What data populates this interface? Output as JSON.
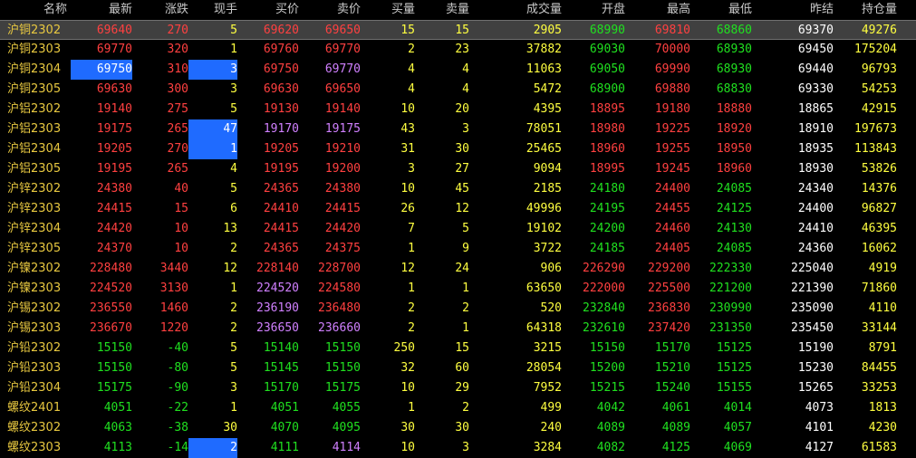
{
  "columns": [
    "名称",
    "最新",
    "涨跌",
    "现手",
    "买价",
    "卖价",
    "买量",
    "卖量",
    "成交量",
    "开盘",
    "最高",
    "最低",
    "昨结",
    "持仓量"
  ],
  "colors": {
    "up": "#ff4040",
    "down": "#20e020",
    "neutral": "#ffffff",
    "yellow": "#ffff40",
    "name": "#e8c840",
    "violet": "#d080ff",
    "highlight": "#1f6bff"
  },
  "rows": [
    {
      "name": "沪铜2302",
      "last": "69640",
      "chg": "270",
      "vol": "5",
      "bid": "69620",
      "ask": "69650",
      "bidq": "15",
      "askq": "15",
      "tvol": "2905",
      "open": "68990",
      "high": "69810",
      "low": "68860",
      "pre": "69370",
      "oi": "49276"
    },
    {
      "name": "沪铜2303",
      "last": "69770",
      "chg": "320",
      "vol": "1",
      "bid": "69760",
      "ask": "69770",
      "bidq": "2",
      "askq": "23",
      "tvol": "37882",
      "open": "69030",
      "high": "70000",
      "low": "68930",
      "pre": "69450",
      "oi": "175204"
    },
    {
      "name": "沪铜2304",
      "last": "69750",
      "chg": "310",
      "vol": "3",
      "bid": "69750",
      "ask": "69770",
      "bidq": "4",
      "askq": "4",
      "tvol": "11063",
      "open": "69050",
      "high": "69990",
      "low": "68930",
      "pre": "69440",
      "oi": "96793"
    },
    {
      "name": "沪铜2305",
      "last": "69630",
      "chg": "300",
      "vol": "3",
      "bid": "69630",
      "ask": "69650",
      "bidq": "4",
      "askq": "4",
      "tvol": "5472",
      "open": "68900",
      "high": "69880",
      "low": "68830",
      "pre": "69330",
      "oi": "54253"
    },
    {
      "name": "沪铝2302",
      "last": "19140",
      "chg": "275",
      "vol": "5",
      "bid": "19130",
      "ask": "19140",
      "bidq": "10",
      "askq": "20",
      "tvol": "4395",
      "open": "18895",
      "high": "19180",
      "low": "18880",
      "pre": "18865",
      "oi": "42915"
    },
    {
      "name": "沪铝2303",
      "last": "19175",
      "chg": "265",
      "vol": "47",
      "bid": "19170",
      "ask": "19175",
      "bidq": "43",
      "askq": "3",
      "tvol": "78051",
      "open": "18980",
      "high": "19225",
      "low": "18920",
      "pre": "18910",
      "oi": "197673"
    },
    {
      "name": "沪铝2304",
      "last": "19205",
      "chg": "270",
      "vol": "1",
      "bid": "19205",
      "ask": "19210",
      "bidq": "31",
      "askq": "30",
      "tvol": "25465",
      "open": "18960",
      "high": "19255",
      "low": "18950",
      "pre": "18935",
      "oi": "113843"
    },
    {
      "name": "沪铝2305",
      "last": "19195",
      "chg": "265",
      "vol": "4",
      "bid": "19195",
      "ask": "19200",
      "bidq": "3",
      "askq": "27",
      "tvol": "9094",
      "open": "18995",
      "high": "19245",
      "low": "18960",
      "pre": "18930",
      "oi": "53826"
    },
    {
      "name": "沪锌2302",
      "last": "24380",
      "chg": "40",
      "vol": "5",
      "bid": "24365",
      "ask": "24380",
      "bidq": "10",
      "askq": "45",
      "tvol": "2185",
      "open": "24180",
      "high": "24400",
      "low": "24085",
      "pre": "24340",
      "oi": "14376"
    },
    {
      "name": "沪锌2303",
      "last": "24415",
      "chg": "15",
      "vol": "6",
      "bid": "24410",
      "ask": "24415",
      "bidq": "26",
      "askq": "12",
      "tvol": "49996",
      "open": "24195",
      "high": "24455",
      "low": "24125",
      "pre": "24400",
      "oi": "96827"
    },
    {
      "name": "沪锌2304",
      "last": "24420",
      "chg": "10",
      "vol": "13",
      "bid": "24415",
      "ask": "24420",
      "bidq": "7",
      "askq": "5",
      "tvol": "19102",
      "open": "24200",
      "high": "24460",
      "low": "24130",
      "pre": "24410",
      "oi": "46395"
    },
    {
      "name": "沪锌2305",
      "last": "24370",
      "chg": "10",
      "vol": "2",
      "bid": "24365",
      "ask": "24375",
      "bidq": "1",
      "askq": "9",
      "tvol": "3722",
      "open": "24185",
      "high": "24405",
      "low": "24085",
      "pre": "24360",
      "oi": "16062"
    },
    {
      "name": "沪镍2302",
      "last": "228480",
      "chg": "3440",
      "vol": "12",
      "bid": "228140",
      "ask": "228700",
      "bidq": "12",
      "askq": "24",
      "tvol": "906",
      "open": "226290",
      "high": "229200",
      "low": "222330",
      "pre": "225040",
      "oi": "4919"
    },
    {
      "name": "沪镍2303",
      "last": "224520",
      "chg": "3130",
      "vol": "1",
      "bid": "224520",
      "ask": "224580",
      "bidq": "1",
      "askq": "1",
      "tvol": "63650",
      "open": "222000",
      "high": "225500",
      "low": "221200",
      "pre": "221390",
      "oi": "71860"
    },
    {
      "name": "沪锡2302",
      "last": "236550",
      "chg": "1460",
      "vol": "2",
      "bid": "236190",
      "ask": "236480",
      "bidq": "2",
      "askq": "2",
      "tvol": "520",
      "open": "232840",
      "high": "236830",
      "low": "230990",
      "pre": "235090",
      "oi": "4110"
    },
    {
      "name": "沪锡2303",
      "last": "236670",
      "chg": "1220",
      "vol": "2",
      "bid": "236650",
      "ask": "236660",
      "bidq": "2",
      "askq": "1",
      "tvol": "64318",
      "open": "232610",
      "high": "237420",
      "low": "231350",
      "pre": "235450",
      "oi": "33144"
    },
    {
      "name": "沪铅2302",
      "last": "15150",
      "chg": "-40",
      "vol": "5",
      "bid": "15140",
      "ask": "15150",
      "bidq": "250",
      "askq": "15",
      "tvol": "3215",
      "open": "15150",
      "high": "15170",
      "low": "15125",
      "pre": "15190",
      "oi": "8791"
    },
    {
      "name": "沪铅2303",
      "last": "15150",
      "chg": "-80",
      "vol": "5",
      "bid": "15145",
      "ask": "15150",
      "bidq": "32",
      "askq": "60",
      "tvol": "28054",
      "open": "15200",
      "high": "15210",
      "low": "15125",
      "pre": "15230",
      "oi": "84455"
    },
    {
      "name": "沪铅2304",
      "last": "15175",
      "chg": "-90",
      "vol": "3",
      "bid": "15170",
      "ask": "15175",
      "bidq": "10",
      "askq": "29",
      "tvol": "7952",
      "open": "15215",
      "high": "15240",
      "low": "15155",
      "pre": "15265",
      "oi": "33253"
    },
    {
      "name": "螺纹2401",
      "last": "4051",
      "chg": "-22",
      "vol": "1",
      "bid": "4051",
      "ask": "4055",
      "bidq": "1",
      "askq": "2",
      "tvol": "499",
      "open": "4042",
      "high": "4061",
      "low": "4014",
      "pre": "4073",
      "oi": "1813"
    },
    {
      "name": "螺纹2302",
      "last": "4063",
      "chg": "-38",
      "vol": "30",
      "bid": "4070",
      "ask": "4095",
      "bidq": "30",
      "askq": "30",
      "tvol": "240",
      "open": "4089",
      "high": "4089",
      "low": "4057",
      "pre": "4101",
      "oi": "4230"
    },
    {
      "name": "螺纹2303",
      "last": "4113",
      "chg": "-14",
      "vol": "2",
      "bid": "4111",
      "ask": "4114",
      "bidq": "10",
      "askq": "3",
      "tvol": "3284",
      "open": "4082",
      "high": "4125",
      "low": "4069",
      "pre": "4127",
      "oi": "61583"
    }
  ]
}
